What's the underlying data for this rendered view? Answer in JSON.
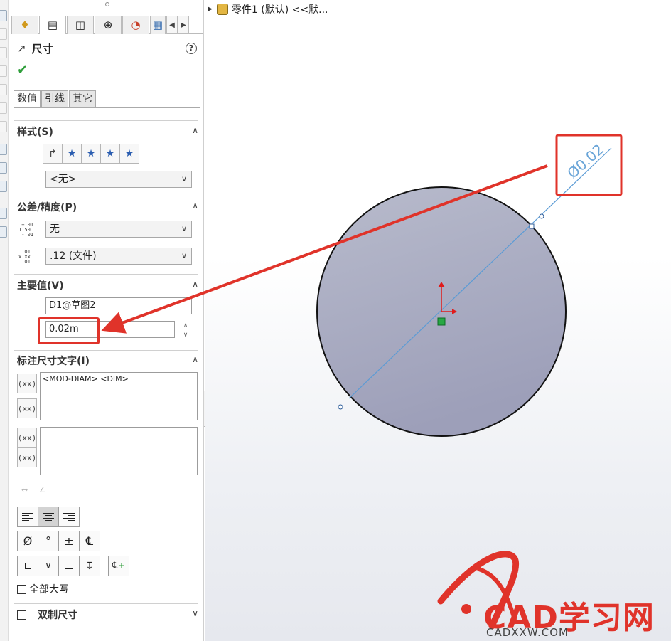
{
  "feature_tree": {
    "item": "零件1 (默认) <<默..."
  },
  "panel": {
    "title": "尺寸",
    "help": "?",
    "ok": "✔",
    "subtabs": [
      "数值",
      "引线",
      "其它"
    ],
    "sections": {
      "style": {
        "title": "样式(S)",
        "dropdown": "<无>"
      },
      "tolerance": {
        "title": "公差/精度(P)",
        "tolerance_type": "无",
        "precision": ".12 (文件)"
      },
      "primary": {
        "title": "主要值(V)",
        "name": "D1@草图2",
        "value": "0.02m"
      },
      "dim_text": {
        "title": "标注尺寸文字(I)",
        "text": "<MOD-DIAM> <DIM>"
      },
      "all_caps": "全部大写",
      "dual": "双制尺寸"
    },
    "symbols": [
      "Ø",
      "°",
      "±",
      "℄"
    ]
  },
  "dimension_label": "Ø0.02",
  "watermark": {
    "brand": "CAD学习网",
    "site": "CADXXW.COM"
  },
  "colors": {
    "accent_red": "#e0332a",
    "dim_blue": "#5b9bd5",
    "circle_fill": "#a9abc2"
  }
}
